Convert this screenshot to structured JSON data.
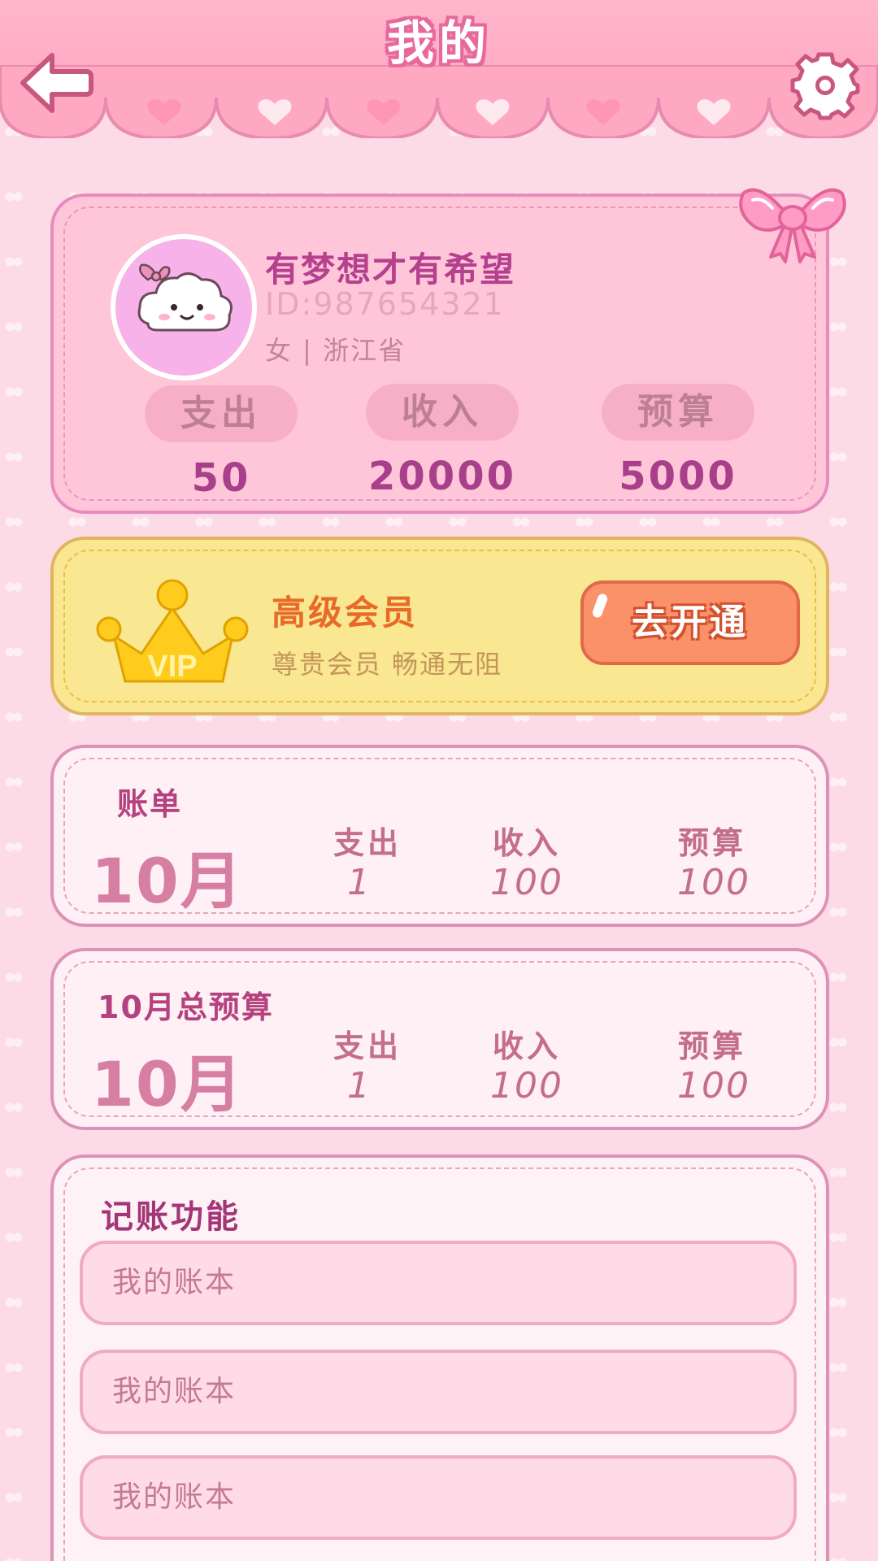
{
  "header": {
    "title": "我的",
    "back_icon": "back-arrow-icon",
    "settings_icon": "gear-icon"
  },
  "profile": {
    "username": "有梦想才有希望",
    "id_text": "ID:987654321",
    "gender_region": "女 | 浙江省",
    "stats": [
      {
        "label": "支出",
        "value": "50"
      },
      {
        "label": "收入",
        "value": "20000"
      },
      {
        "label": "预算",
        "value": "5000"
      }
    ]
  },
  "vip": {
    "badge_text": "VIP",
    "title": "高级会员",
    "subtitle": "尊贵会员  畅通无阻",
    "button_label": "去开通"
  },
  "bills": [
    {
      "label": "账单",
      "month": "10月",
      "columns": [
        {
          "header": "支出",
          "value": "1"
        },
        {
          "header": "收入",
          "value": "100"
        },
        {
          "header": "预算",
          "value": "100"
        }
      ]
    },
    {
      "label": "10月总预算",
      "month": "10月",
      "columns": [
        {
          "header": "支出",
          "value": "1"
        },
        {
          "header": "收入",
          "value": "100"
        },
        {
          "header": "预算",
          "value": "100"
        }
      ]
    }
  ],
  "features": {
    "title": "记账功能",
    "items": [
      "我的账本",
      "我的账本",
      "我的账本"
    ]
  },
  "colors": {
    "primary_pink": "#ffb6cc",
    "accent_magenta": "#b4408e",
    "vip_yellow": "#f9e791",
    "vip_button": "#fb9168"
  }
}
